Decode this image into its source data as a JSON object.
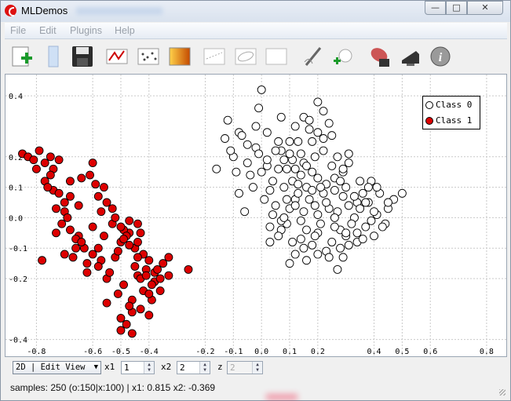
{
  "window": {
    "title": "MLDemos",
    "minimize": "—",
    "maximize": "□",
    "close": "✕"
  },
  "menu": [
    "File",
    "Edit",
    "Plugins",
    "Help"
  ],
  "toolbar": {
    "icons": [
      "add-data-icon",
      "clear-icon",
      "save-icon",
      "draw-icon",
      "samples-icon",
      "heatmap-icon",
      "classifier-icon",
      "ellipse-icon",
      "blank-icon",
      "pen-icon",
      "add-sample-icon",
      "screenshot-icon",
      "display-icon",
      "info-icon"
    ]
  },
  "plot": {
    "legend": [
      {
        "label": "Class 0",
        "color": "#ffffff"
      },
      {
        "label": "Class 1",
        "color": "#dd0000"
      }
    ],
    "class_colors": {
      "0": "#ffffff",
      "1": "#dd0000"
    }
  },
  "chart_data": {
    "type": "scatter",
    "title": "",
    "xlabel": "",
    "ylabel": "",
    "xlim": [
      -0.91,
      0.87
    ],
    "ylim": [
      -0.455,
      0.47
    ],
    "xticks": [
      "-0.8",
      "-0.6",
      "-0.5",
      "-0.4",
      "-0.2",
      "-0.1",
      "0.0",
      "0.1",
      "0.2",
      "0.4",
      "0.5",
      "0.6",
      "0.8"
    ],
    "yticks": [
      "0.4",
      "0.2",
      "0.1",
      "0.0",
      "-0.1",
      "-0.2",
      "-0.4"
    ],
    "grid": true,
    "legend_position": "top-right",
    "series": [
      {
        "name": "Class 0",
        "color": "#ffffff",
        "points": [
          [
            -0.08,
            0.28
          ],
          [
            -0.01,
            0.36
          ],
          [
            0.07,
            0.22
          ],
          [
            0.15,
            0.33
          ],
          [
            0.31,
            0.21
          ],
          [
            0.12,
            0.06
          ],
          [
            0.26,
            0.09
          ],
          [
            0.38,
            0.05
          ],
          [
            0.16,
            -0.04
          ],
          [
            0.23,
            -0.11
          ],
          [
            0.03,
            -0.08
          ],
          [
            0.2,
            0.28
          ],
          [
            -0.05,
            0.18
          ],
          [
            0.11,
            0.12
          ],
          [
            0.39,
            0.12
          ],
          [
            0.3,
            -0.06
          ],
          [
            0.47,
            0.06
          ],
          [
            0.07,
            -0.04
          ],
          [
            -0.16,
            0.16
          ],
          [
            0.0,
            0.42
          ],
          [
            0.1,
            -0.15
          ],
          [
            0.27,
            -0.17
          ],
          [
            0.18,
            0.15
          ],
          [
            0.36,
            0.08
          ],
          [
            0.44,
            -0.02
          ],
          [
            0.13,
            0.25
          ],
          [
            -0.08,
            0.08
          ],
          [
            0.24,
            0.03
          ],
          [
            0.5,
            0.08
          ],
          [
            0.02,
            0.17
          ],
          [
            -0.12,
            0.32
          ],
          [
            0.08,
            0.1
          ],
          [
            0.17,
            0.32
          ],
          [
            0.29,
            0.15
          ],
          [
            0.19,
            0.04
          ],
          [
            -0.02,
            0.23
          ],
          [
            0.34,
            -0.08
          ],
          [
            0.45,
            0.03
          ],
          [
            0.14,
            -0.01
          ],
          [
            0.04,
            0.01
          ],
          [
            -0.03,
            0.1
          ],
          [
            0.22,
            0.35
          ],
          [
            0.31,
            -0.09
          ],
          [
            0.41,
            0.01
          ],
          [
            0.09,
            0.16
          ],
          [
            -0.06,
            0.02
          ],
          [
            0.2,
            -0.05
          ],
          [
            0.26,
            0.13
          ],
          [
            0.12,
            -0.12
          ],
          [
            0.01,
            0.06
          ],
          [
            0.15,
            0.18
          ],
          [
            0.28,
            -0.04
          ],
          [
            0.35,
            0.12
          ],
          [
            0.06,
            0.25
          ],
          [
            -0.1,
            0.2
          ],
          [
            0.22,
            0.08
          ],
          [
            0.18,
            -0.09
          ],
          [
            0.4,
            -0.06
          ],
          [
            0.1,
            0.03
          ],
          [
            0.25,
            0.27
          ],
          [
            -0.04,
            0.14
          ],
          [
            0.33,
            0.0
          ],
          [
            0.07,
            0.33
          ],
          [
            0.16,
            0.1
          ],
          [
            0.24,
            -0.13
          ],
          [
            0.02,
            0.28
          ],
          [
            0.29,
            0.07
          ],
          [
            -0.13,
            0.26
          ],
          [
            0.19,
            0.2
          ],
          [
            0.37,
            -0.03
          ],
          [
            0.11,
            0.19
          ],
          [
            0.05,
            0.04
          ],
          [
            0.21,
            -0.02
          ],
          [
            0.14,
            -0.07
          ],
          [
            0.3,
            0.1
          ],
          [
            -0.01,
            0.21
          ],
          [
            0.27,
            0.02
          ],
          [
            0.09,
            -0.02
          ],
          [
            0.17,
            0.06
          ],
          [
            0.42,
            0.08
          ],
          [
            -0.07,
            0.27
          ],
          [
            0.23,
            0.11
          ],
          [
            0.12,
            0.3
          ],
          [
            0.34,
            0.05
          ],
          [
            0.2,
            0.38
          ],
          [
            0.04,
            0.12
          ],
          [
            0.28,
            -0.1
          ],
          [
            0.15,
            0.02
          ],
          [
            0.36,
            -0.07
          ],
          [
            0.08,
            0.19
          ],
          [
            0.25,
            0.17
          ],
          [
            0.0,
            0.15
          ],
          [
            0.18,
            0.25
          ],
          [
            0.32,
            -0.02
          ],
          [
            0.13,
            0.08
          ],
          [
            0.06,
            -0.06
          ],
          [
            0.22,
            0.22
          ],
          [
            0.43,
            -0.03
          ],
          [
            -0.09,
            0.15
          ],
          [
            0.16,
            -0.14
          ],
          [
            0.26,
            0.0
          ],
          [
            0.38,
            0.1
          ],
          [
            0.1,
            0.25
          ],
          [
            0.2,
            0.13
          ],
          [
            0.03,
            0.09
          ],
          [
            0.29,
            -0.13
          ],
          [
            0.14,
            0.14
          ],
          [
            0.35,
            0.03
          ],
          [
            0.24,
            0.31
          ],
          [
            0.07,
            -0.01
          ],
          [
            -0.05,
            0.24
          ],
          [
            0.19,
            -0.06
          ],
          [
            0.31,
            0.04
          ],
          [
            0.12,
            0.16
          ],
          [
            0.27,
            0.2
          ],
          [
            0.4,
            0.02
          ],
          [
            0.02,
            0.19
          ],
          [
            0.21,
            0.1
          ],
          [
            0.15,
            -0.1
          ],
          [
            0.33,
            0.07
          ],
          [
            0.09,
            0.06
          ],
          [
            0.25,
            -0.08
          ],
          [
            0.17,
            0.29
          ],
          [
            -0.02,
            0.3
          ],
          [
            0.37,
            0.05
          ],
          [
            0.11,
            -0.08
          ],
          [
            0.23,
            0.05
          ],
          [
            0.05,
            0.22
          ],
          [
            0.3,
            -0.05
          ],
          [
            0.14,
            0.21
          ],
          [
            0.2,
            -0.12
          ],
          [
            0.41,
            0.1
          ],
          [
            0.08,
            0.0
          ],
          [
            0.28,
            0.12
          ],
          [
            -0.11,
            0.22
          ],
          [
            0.18,
            0.09
          ],
          [
            0.34,
            -0.05
          ],
          [
            0.12,
            0.04
          ],
          [
            0.26,
            -0.03
          ],
          [
            0.06,
            0.16
          ],
          [
            0.22,
            0.26
          ],
          [
            0.45,
            0.05
          ],
          [
            0.16,
            0.17
          ],
          [
            0.03,
            -0.03
          ],
          [
            0.29,
            0.16
          ],
          [
            0.1,
            0.21
          ],
          [
            0.39,
            -0.01
          ],
          [
            0.2,
            0.01
          ],
          [
            0.13,
            0.11
          ],
          [
            0.31,
            0.18
          ]
        ]
      },
      {
        "name": "Class 1",
        "color": "#dd0000",
        "points": [
          [
            -0.85,
            0.21
          ],
          [
            -0.75,
            0.2
          ],
          [
            -0.8,
            0.16
          ],
          [
            -0.77,
            0.12
          ],
          [
            -0.74,
            0.09
          ],
          [
            -0.68,
            0.07
          ],
          [
            -0.7,
            0.02
          ],
          [
            -0.65,
            -0.06
          ],
          [
            -0.58,
            -0.1
          ],
          [
            -0.5,
            -0.08
          ],
          [
            -0.44,
            -0.02
          ],
          [
            -0.47,
            -0.05
          ],
          [
            -0.42,
            -0.12
          ],
          [
            -0.38,
            -0.18
          ],
          [
            -0.46,
            -0.27
          ],
          [
            -0.4,
            -0.32
          ],
          [
            -0.36,
            -0.24
          ],
          [
            -0.55,
            -0.2
          ],
          [
            -0.62,
            -0.15
          ],
          [
            -0.7,
            -0.12
          ],
          [
            -0.78,
            -0.14
          ],
          [
            -0.83,
            0.2
          ],
          [
            -0.72,
            0.19
          ],
          [
            -0.6,
            0.18
          ],
          [
            -0.55,
            0.05
          ],
          [
            -0.53,
            -0.02
          ],
          [
            -0.49,
            -0.04
          ],
          [
            -0.45,
            -0.1
          ],
          [
            -0.48,
            -0.35
          ],
          [
            -0.5,
            -0.37
          ],
          [
            -0.43,
            -0.3
          ],
          [
            -0.38,
            -0.21
          ],
          [
            -0.33,
            -0.19
          ],
          [
            -0.6,
            -0.03
          ],
          [
            -0.66,
            -0.1
          ],
          [
            -0.73,
            -0.05
          ],
          [
            -0.76,
            0.1
          ],
          [
            -0.64,
            0.13
          ],
          [
            -0.58,
            0.07
          ],
          [
            -0.52,
            -0.13
          ],
          [
            -0.44,
            -0.19
          ],
          [
            -0.4,
            -0.14
          ],
          [
            -0.37,
            -0.17
          ],
          [
            -0.55,
            -0.28
          ],
          [
            -0.62,
            -0.18
          ],
          [
            -0.69,
            0.0
          ],
          [
            -0.79,
            0.22
          ],
          [
            -0.68,
            0.12
          ],
          [
            -0.56,
            -0.06
          ],
          [
            -0.47,
            -0.09
          ],
          [
            -0.43,
            -0.2
          ],
          [
            -0.39,
            -0.27
          ],
          [
            -0.46,
            -0.31
          ],
          [
            -0.51,
            -0.25
          ],
          [
            -0.63,
            -0.1
          ],
          [
            -0.71,
            -0.02
          ],
          [
            -0.74,
            0.16
          ],
          [
            -0.59,
            0.11
          ],
          [
            -0.53,
            0.03
          ],
          [
            -0.47,
            -0.01
          ],
          [
            -0.44,
            -0.08
          ],
          [
            -0.41,
            -0.17
          ],
          [
            -0.36,
            -0.2
          ],
          [
            -0.49,
            -0.22
          ],
          [
            -0.57,
            -0.14
          ],
          [
            -0.66,
            -0.07
          ],
          [
            -0.73,
            0.03
          ],
          [
            -0.77,
            0.18
          ],
          [
            -0.61,
            0.14
          ],
          [
            -0.52,
            0.0
          ],
          [
            -0.48,
            -0.06
          ],
          [
            -0.45,
            -0.16
          ],
          [
            -0.42,
            -0.24
          ],
          [
            -0.5,
            -0.33
          ],
          [
            -0.6,
            -0.12
          ],
          [
            -0.68,
            -0.04
          ],
          [
            -0.75,
            0.14
          ],
          [
            -0.56,
            0.1
          ],
          [
            -0.5,
            -0.03
          ],
          [
            -0.43,
            -0.05
          ],
          [
            -0.39,
            -0.22
          ],
          [
            -0.35,
            -0.15
          ],
          [
            -0.47,
            -0.29
          ],
          [
            -0.54,
            -0.18
          ],
          [
            -0.64,
            -0.08
          ],
          [
            -0.7,
            0.05
          ],
          [
            -0.81,
            0.19
          ],
          [
            -0.65,
            0.04
          ],
          [
            -0.51,
            -0.11
          ],
          [
            -0.44,
            -0.13
          ],
          [
            -0.4,
            -0.25
          ],
          [
            -0.46,
            -0.38
          ],
          [
            -0.58,
            -0.16
          ],
          [
            -0.67,
            -0.13
          ],
          [
            -0.72,
            0.08
          ],
          [
            -0.57,
            0.02
          ],
          [
            -0.49,
            -0.07
          ],
          [
            -0.41,
            -0.19
          ],
          [
            -0.33,
            -0.13
          ],
          [
            -0.26,
            -0.17
          ]
        ]
      }
    ]
  },
  "controls": {
    "view_mode": "2D | Edit View",
    "x1_label": "x1",
    "x1_value": "1",
    "x2_label": "x2",
    "x2_value": "2",
    "z_label": "z",
    "z_value": "2"
  },
  "status": "samples: 250 (o:150|x:100) | x1: 0.815 x2: -0.369"
}
